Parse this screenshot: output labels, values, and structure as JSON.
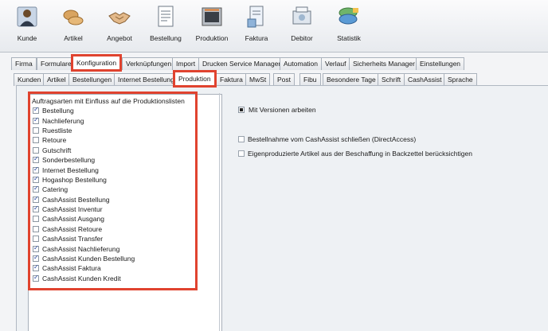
{
  "toolbar": {
    "items": [
      {
        "label": "Kunde",
        "icon": "person-icon"
      },
      {
        "label": "Artikel",
        "icon": "bread-icon"
      },
      {
        "label": "Angebot",
        "icon": "handshake-icon"
      },
      {
        "label": "Bestellung",
        "icon": "order-document-icon"
      },
      {
        "label": "Produktion",
        "icon": "oven-icon"
      },
      {
        "label": "Faktura",
        "icon": "invoice-icon"
      },
      {
        "label": "Debitor",
        "icon": "debitor-icon"
      },
      {
        "label": "Statistik",
        "icon": "statistics-icon"
      }
    ]
  },
  "tabs_main": [
    "Firma",
    "Formulare",
    "Konfiguration",
    "Verknüpfungen",
    "Import",
    "Drucken Service Manager",
    "Automation",
    "Verlauf",
    "Sicherheits Manager",
    "Einstellungen"
  ],
  "tabs_sub": [
    "Kunden",
    "Artikel",
    "Bestellungen",
    "Internet Bestellung",
    "Produktion",
    "Faktura",
    "MwSt",
    "Post",
    "Fibu",
    "Besondere Tage",
    "Schrift",
    "CashAssist",
    "Sprache"
  ],
  "list": {
    "title": "Auftragsarten mit Einfluss auf die Produktionslisten",
    "items": [
      {
        "label": "Bestellung",
        "checked": true
      },
      {
        "label": "Nachlieferung",
        "checked": true
      },
      {
        "label": "Ruestliste",
        "checked": false
      },
      {
        "label": "Retoure",
        "checked": false
      },
      {
        "label": "Gutschrift",
        "checked": false
      },
      {
        "label": "Sonderbestellung",
        "checked": true
      },
      {
        "label": "Internet Bestellung",
        "checked": true
      },
      {
        "label": "Hogashop Bestellung",
        "checked": true
      },
      {
        "label": "Catering",
        "checked": true
      },
      {
        "label": "CashAssist Bestellung",
        "checked": true
      },
      {
        "label": "CashAssist Inventur",
        "checked": true
      },
      {
        "label": "CashAssist Ausgang",
        "checked": false
      },
      {
        "label": "CashAssist Retoure",
        "checked": false
      },
      {
        "label": "CashAssist Transfer",
        "checked": false
      },
      {
        "label": "CashAssist Nachlieferung",
        "checked": true
      },
      {
        "label": "CashAssist Kunden Bestellung",
        "checked": true
      },
      {
        "label": "CashAssist Faktura",
        "checked": true
      },
      {
        "label": "CashAssist Kunden Kredit",
        "checked": true
      }
    ]
  },
  "options": {
    "versions_label": "Mit Versionen arbeiten",
    "versions_selected": true,
    "cashassist_label": "Bestellnahme vom CashAssist schließen (DirectAccess)",
    "cashassist_checked": false,
    "eigen_label": "Eigenproduzierte Artikel aus der Beschaffung in Backzettel berücksichtigen",
    "eigen_checked": false
  },
  "colors": {
    "highlight": "#e0432f",
    "accent": "#1f3fa0"
  }
}
